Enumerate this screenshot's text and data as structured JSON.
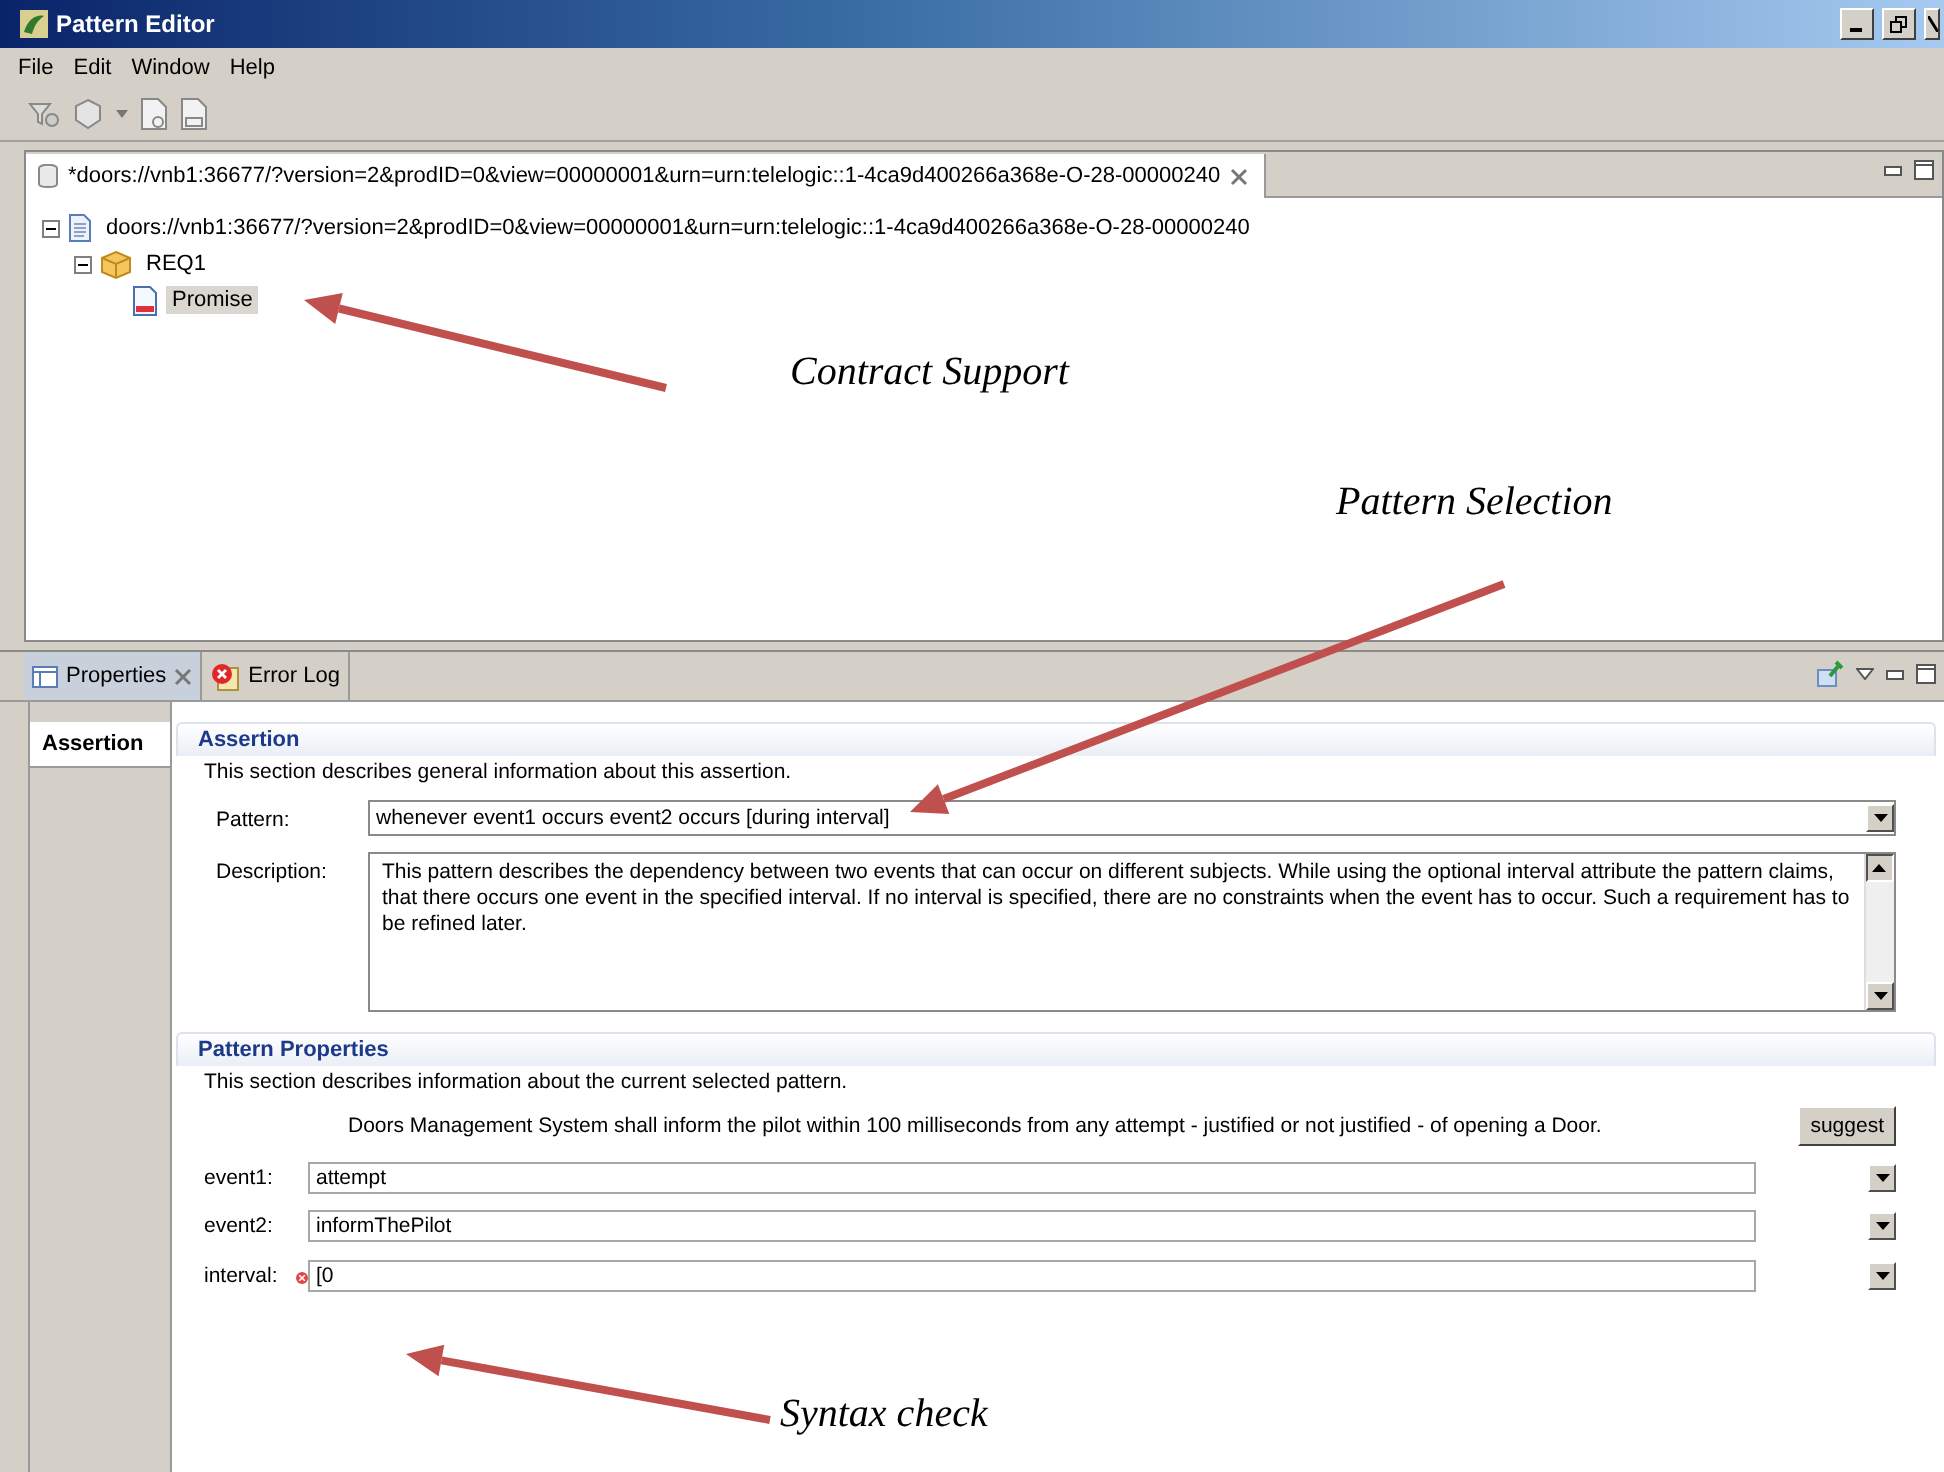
{
  "window": {
    "title": "Pattern Editor"
  },
  "menu": [
    "File",
    "Edit",
    "Window",
    "Help"
  ],
  "editor_tab": {
    "title": "*doors://vnb1:36677/?version=2&prodID=0&view=00000001&urn=urn:telelogic::1-4ca9d400266a368e-O-28-00000240"
  },
  "tree": [
    {
      "label": "doors://vnb1:36677/?version=2&prodID=0&view=00000001&urn=urn:telelogic::1-4ca9d400266a368e-O-28-00000240",
      "kind": "document",
      "expanded": true,
      "selected": false,
      "children": [
        {
          "label": "REQ1",
          "kind": "package",
          "expanded": true,
          "selected": false,
          "children": [
            {
              "label": "Promise",
              "kind": "requirement",
              "selected": true
            }
          ]
        }
      ]
    }
  ],
  "view_tabs": [
    {
      "label": "Properties",
      "selected": true,
      "closable": true,
      "kind": "properties"
    },
    {
      "label": "Error Log",
      "selected": false,
      "closable": false,
      "kind": "errorlog"
    }
  ],
  "side_tabs": [
    {
      "label": "Assertion",
      "selected": true
    }
  ],
  "assertion": {
    "title": "Assertion",
    "description": "This section describes general information about this assertion.",
    "pattern_label": "Pattern:",
    "pattern": "whenever event1 occurs event2 occurs [during interval]",
    "description_label": "Description:",
    "description_text": "This pattern describes the dependency between two events that can occur on different subjects. While using the optional interval attribute the pattern claims, that there occurs one event in the specified interval. If no interval is specified, there are no constraints when the event has to occur. Such a requirement has to be refined later."
  },
  "pattern_properties": {
    "title": "Pattern Properties",
    "description": "This section describes information about the current selected pattern.",
    "requirement": "Doors Management System shall inform the pilot within 100 milliseconds from any attempt - justified or not justified - of opening a Door.",
    "suggest_button": "suggest",
    "params": [
      {
        "label": "event1:",
        "value": "attempt",
        "error": false
      },
      {
        "label": "event2:",
        "value": "informThePilot",
        "error": false
      },
      {
        "label": "interval:",
        "value": "[0",
        "error": true
      }
    ]
  },
  "annotations": [
    {
      "text": "Contract Support"
    },
    {
      "text": "Pattern Selection"
    },
    {
      "text": "Syntax check"
    }
  ]
}
